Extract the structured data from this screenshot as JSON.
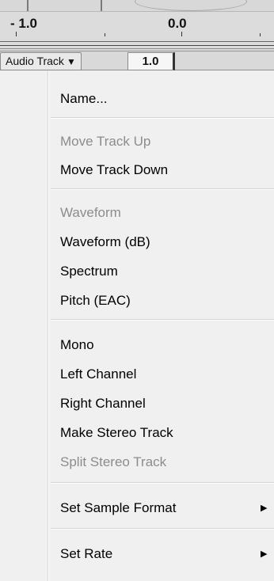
{
  "ruler": {
    "labels": [
      "- 1.0",
      "0.0"
    ]
  },
  "track": {
    "name_button": "Audio Track",
    "dropdown_arrow": "▼",
    "gain_value": "1.0"
  },
  "menu": {
    "items": [
      {
        "label": "Name...",
        "enabled": true
      },
      {
        "label": "Move Track Up",
        "enabled": false
      },
      {
        "label": "Move Track Down",
        "enabled": true
      },
      {
        "label": "Waveform",
        "enabled": false
      },
      {
        "label": "Waveform (dB)",
        "enabled": true
      },
      {
        "label": "Spectrum",
        "enabled": true
      },
      {
        "label": "Pitch (EAC)",
        "enabled": true
      },
      {
        "label": "Mono",
        "enabled": true
      },
      {
        "label": "Left Channel",
        "enabled": true
      },
      {
        "label": "Right Channel",
        "enabled": true
      },
      {
        "label": "Make Stereo Track",
        "enabled": true
      },
      {
        "label": "Split Stereo Track",
        "enabled": false
      },
      {
        "label": "Set Sample Format",
        "enabled": true,
        "submenu": true
      },
      {
        "label": "Set Rate",
        "enabled": true,
        "submenu": true
      }
    ],
    "submenu_arrow": "▶"
  },
  "colors": {
    "menu_background": "#f0f0f0",
    "disabled_text": "#8c8c8c",
    "enabled_text": "#000000"
  }
}
